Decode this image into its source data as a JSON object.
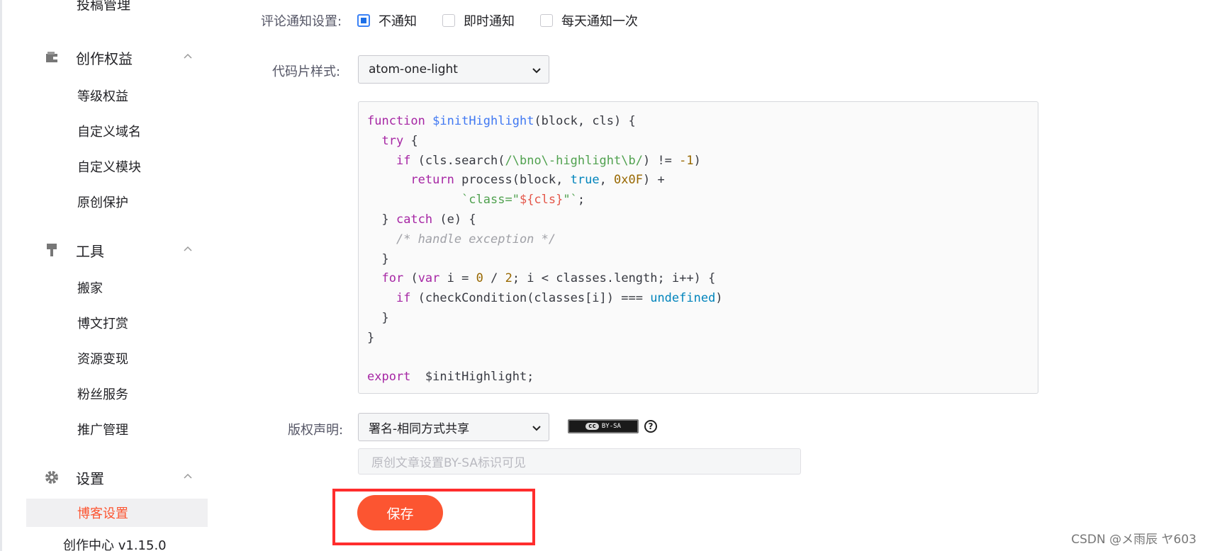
{
  "sidebar": {
    "cut_item": "投稿管理",
    "groups": [
      {
        "label": "创作权益",
        "icon": "wallet-icon",
        "items": [
          "等级权益",
          "自定义域名",
          "自定义模块",
          "原创保护"
        ]
      },
      {
        "label": "工具",
        "icon": "brush-icon",
        "items": [
          "搬家",
          "博文打赏",
          "资源变现",
          "粉丝服务",
          "推广管理"
        ]
      },
      {
        "label": "设置",
        "icon": "gear-icon",
        "items": [
          "博客设置"
        ]
      }
    ],
    "version": "创作中心 v1.15.0"
  },
  "settings": {
    "comment_notify": {
      "label": "评论通知设置:",
      "options": [
        "不通知",
        "即时通知",
        "每天通知一次"
      ],
      "selected": "不通知"
    },
    "code_style": {
      "label": "代码片样式:",
      "value": "atom-one-light"
    },
    "copyright": {
      "label": "版权声明:",
      "value": "署名-相同方式共享",
      "badge_cc": "cc",
      "badge_text": "BY-SA",
      "help": "?",
      "note_placeholder": "原创文章设置BY-SA标识可见"
    },
    "save_label": "保存"
  },
  "watermark": "CSDN @メ雨辰  ヤ603",
  "colors": {
    "accent": "#fc5531",
    "checkbox_checked": "#1d6fe6",
    "highlight_frame": "#ff2d2d"
  }
}
